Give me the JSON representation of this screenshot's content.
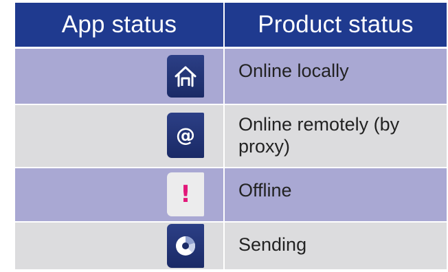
{
  "header": {
    "app_status": "App status",
    "product_status": "Product status"
  },
  "rows": [
    {
      "icon": "home-icon",
      "product_status": "Online locally"
    },
    {
      "icon": "at-sign-icon",
      "icon_glyph": "@",
      "product_status": "Online remotely (by proxy)"
    },
    {
      "icon": "exclamation-icon",
      "icon_glyph": "!",
      "product_status": "Offline"
    },
    {
      "icon": "sending-progress-icon",
      "product_status": "Sending"
    }
  ],
  "colors": {
    "header_bg": "#1f3a8f",
    "row_purple": "#a9a8d3",
    "row_gray": "#dcdcde",
    "icon_tile_navy": "#2c3f86",
    "offline_accent": "#e2187a"
  }
}
